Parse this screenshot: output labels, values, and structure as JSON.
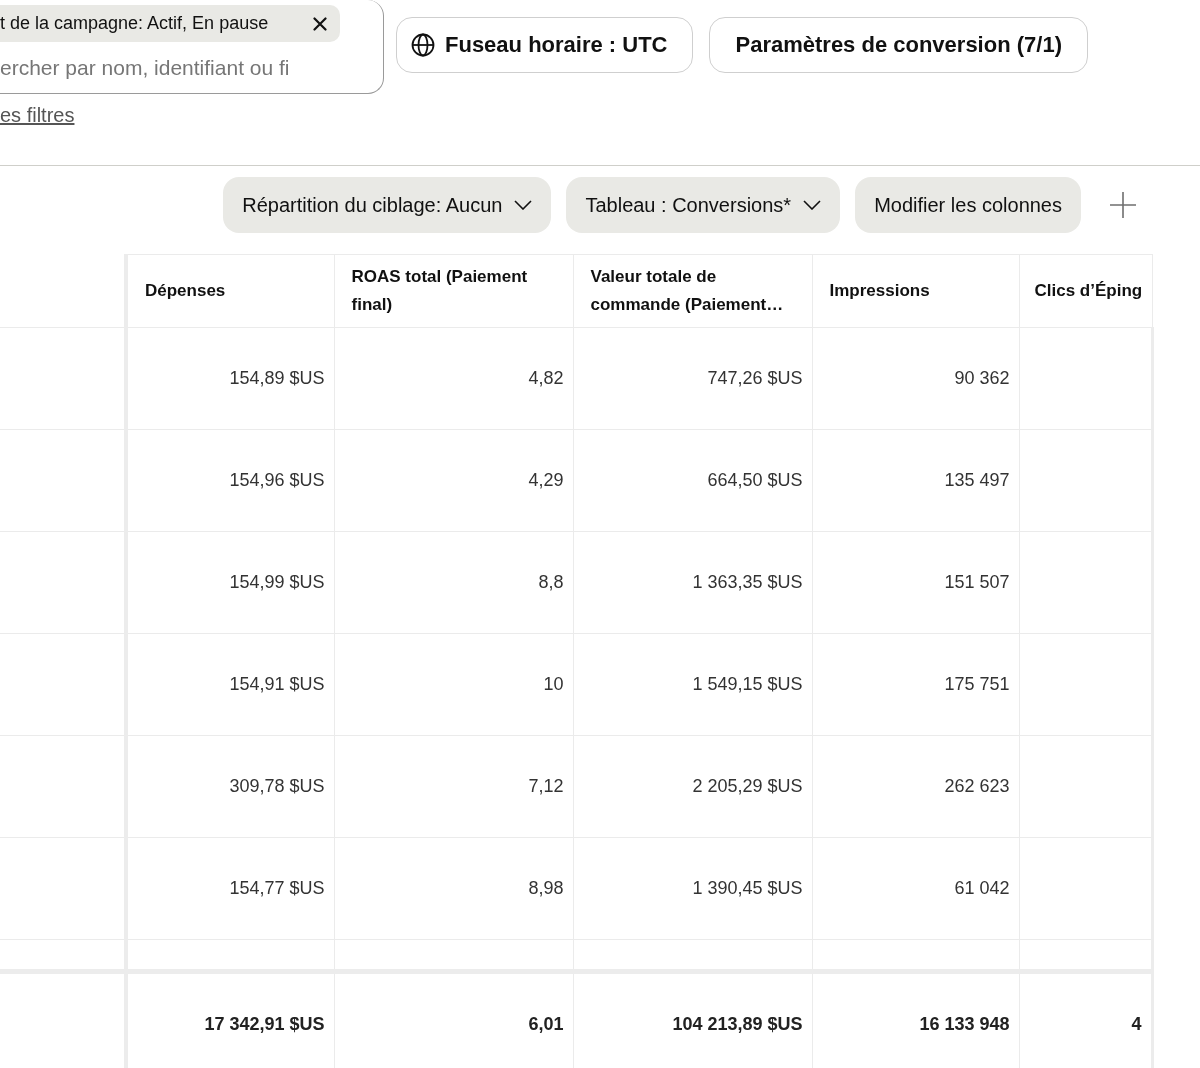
{
  "filters": {
    "chip": {
      "label": "t de la campagne: Actif, En pause"
    },
    "search": {
      "placeholder": "ercher par nom, identifiant ou fi"
    },
    "link": "es filtres"
  },
  "buttons": [
    {
      "kind": "timezone",
      "label": "Fuseau horaire : UTC"
    },
    {
      "kind": "plain",
      "label": "Paramètres de conversion (7/1)"
    }
  ],
  "toolbar": [
    {
      "kind": "dropdown",
      "label": "Répartition du ciblage: Aucun"
    },
    {
      "kind": "dropdown",
      "label": "Tableau : Conversions*"
    },
    {
      "kind": "button",
      "label": "Modifier les colonnes"
    },
    {
      "kind": "add"
    }
  ],
  "table": {
    "columns": [
      "Dépenses",
      "ROAS total (Paiement final)",
      "Valeur totale de commande (Paiement…",
      "Impressions",
      "Clics d’Éping"
    ],
    "rows": [
      {
        "cells": [
          "154,89 $US",
          "4,82",
          "747,26 $US",
          "90 362"
        ]
      },
      {
        "cells": [
          "154,96 $US",
          "4,29",
          "664,50 $US",
          "135 497"
        ]
      },
      {
        "cells": [
          "154,99 $US",
          "8,8",
          "1 363,35 $US",
          "151 507"
        ]
      },
      {
        "cells": [
          "154,91 $US",
          "10",
          "1 549,15 $US",
          "175 751"
        ]
      },
      {
        "cells": [
          "309,78 $US",
          "7,12",
          "2 205,29 $US",
          "262 623"
        ]
      },
      {
        "cells": [
          "154,77 $US",
          "8,98",
          "1 390,45 $US",
          "61 042"
        ]
      }
    ],
    "totals": [
      "17 342,91 $US",
      "6,01",
      "104 213,89 $US",
      "16 133 948",
      "4"
    ]
  }
}
